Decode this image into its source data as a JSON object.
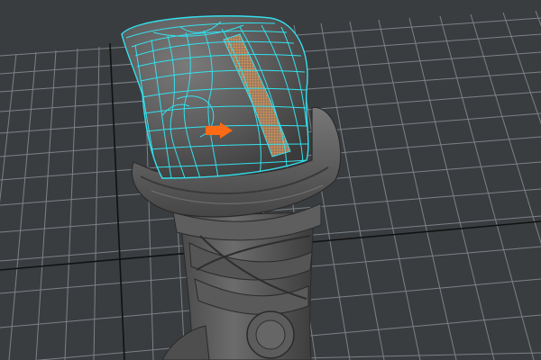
{
  "viewport": {
    "background_color": "#3a3d40",
    "grid_color": "#7c8186",
    "grid_axis_color": "#111111"
  },
  "model": {
    "base_color": "#5a5a5a",
    "highlight_color": "#777777",
    "wireframe_color": "#33e1ee",
    "selected_face_color": "#c98a55"
  },
  "manipulator": {
    "icon": "move-arrow-icon",
    "color": "#ff6a14"
  }
}
